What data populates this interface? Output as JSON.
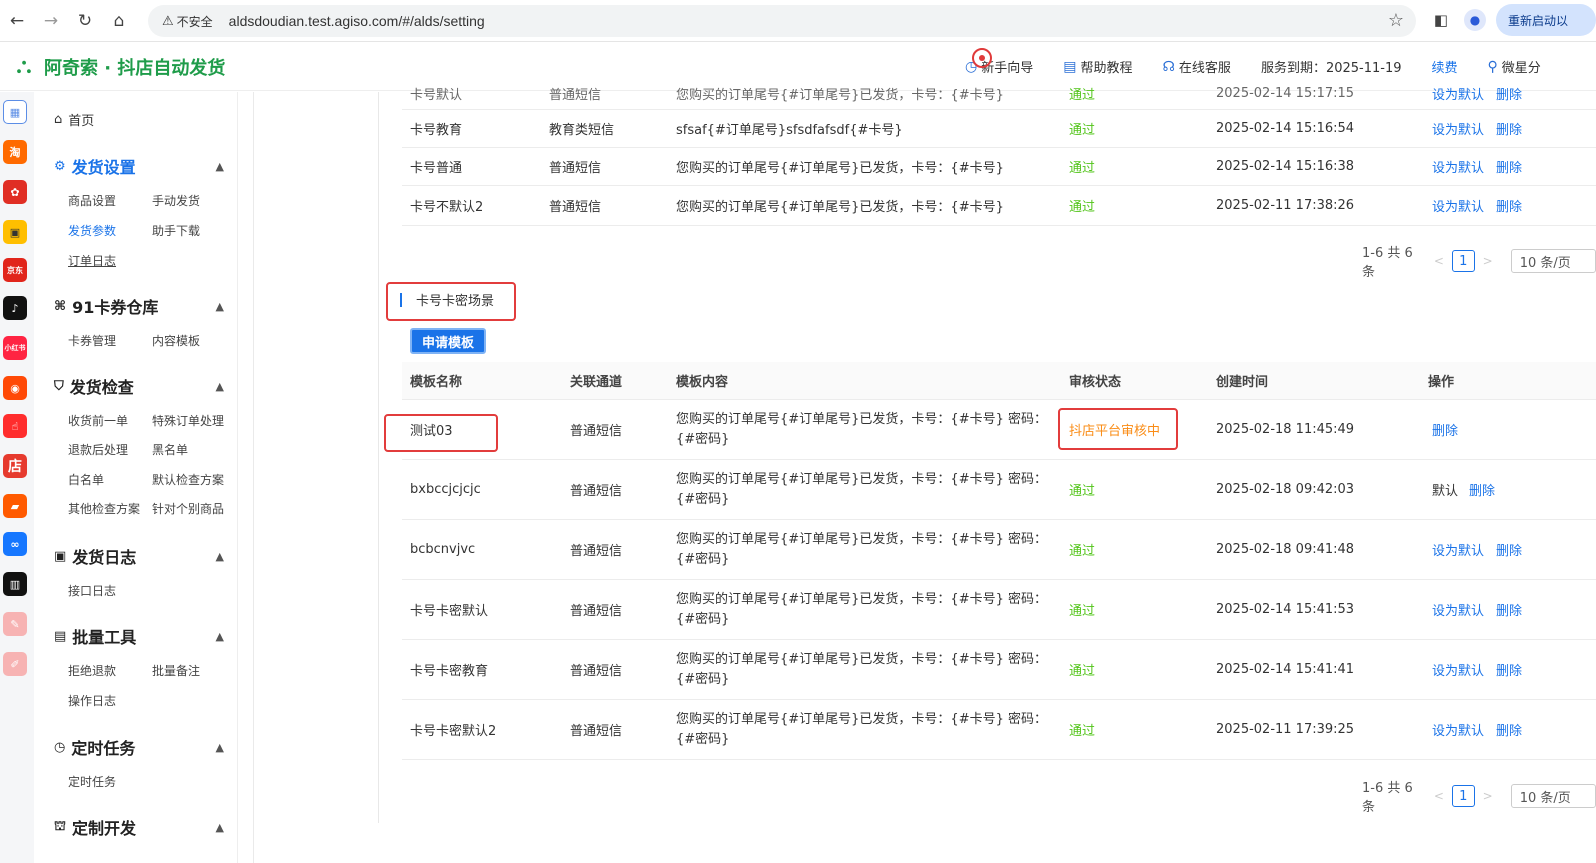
{
  "browser": {
    "insecure_label": "不安全",
    "url": "aldsdoudian.test.agiso.com/#/alds/setting",
    "relaunch_label": "重新启动以"
  },
  "header": {
    "logo_text": "阿奇索 · 抖店自动发货",
    "links": {
      "guide": "新手向导",
      "help": "帮助教程",
      "support": "在线客服",
      "service_expiry": "服务到期：2025-11-19",
      "renew": "续费",
      "user": "微星分"
    }
  },
  "sidebar": {
    "home": "首页",
    "groups": [
      {
        "title": "发货设置",
        "items": [
          "商品设置",
          "手动发货",
          "发货参数",
          "助手下载",
          "订单日志"
        ]
      },
      {
        "title": "91卡券仓库",
        "items": [
          "卡券管理",
          "内容模板"
        ]
      },
      {
        "title": "发货检查",
        "items": [
          "收货前一单",
          "特殊订单处理",
          "退款后处理",
          "黑名单",
          "白名单",
          "默认检查方案",
          "其他检查方案",
          "针对个别商品"
        ]
      },
      {
        "title": "发货日志",
        "items": [
          "接口日志"
        ]
      },
      {
        "title": "批量工具",
        "items": [
          "拒绝退款",
          "批量备注",
          "操作日志"
        ]
      },
      {
        "title": "定时任务",
        "items": [
          "定时任务"
        ]
      },
      {
        "title": "定制开发",
        "items": []
      }
    ]
  },
  "top_table": {
    "rows": [
      {
        "name": "卡号默认",
        "channel": "普通短信",
        "content": "您购买的订单尾号{#订单尾号}已发货，卡号：{#卡号}",
        "status": "通过",
        "time": "2025-02-14 15:17:15",
        "default": "设为默认",
        "delete": "删除"
      },
      {
        "name": "卡号教育",
        "channel": "教育类短信",
        "content": "sfsaf{#订单尾号}sfsdfafsdf{#卡号}",
        "status": "通过",
        "time": "2025-02-14 15:16:54",
        "default": "设为默认",
        "delete": "删除"
      },
      {
        "name": "卡号普通",
        "channel": "普通短信",
        "content": "您购买的订单尾号{#订单尾号}已发货，卡号：{#卡号}",
        "status": "通过",
        "time": "2025-02-14 15:16:38",
        "default": "设为默认",
        "delete": "删除"
      },
      {
        "name": "卡号不默认2",
        "channel": "普通短信",
        "content": "您购买的订单尾号{#订单尾号}已发货，卡号：{#卡号}",
        "status": "通过",
        "time": "2025-02-11 17:38:26",
        "default": "设为默认",
        "delete": "删除"
      }
    ],
    "pager": {
      "summary": "1-6 共 6 条",
      "page": "1",
      "size": "10 条/页"
    }
  },
  "card_section": {
    "title": "卡号卡密场景",
    "apply_button": "申请模板",
    "columns": [
      "模板名称",
      "关联通道",
      "模板内容",
      "审核状态",
      "创建时间",
      "操作"
    ],
    "rows": [
      {
        "name": "测试03",
        "channel": "普通短信",
        "content1": "您购买的订单尾号{#订单尾号}已发货，卡号：{#卡号} 密码：",
        "content2": "{#密码}",
        "status": "抖店平台审核中",
        "time": "2025-02-18 11:45:49",
        "default": "",
        "delete": "删除"
      },
      {
        "name": "bxbccjcjcjc",
        "channel": "普通短信",
        "content1": "您购买的订单尾号{#订单尾号}已发货，卡号：{#卡号} 密码：",
        "content2": "{#密码}",
        "status": "通过",
        "time": "2025-02-18 09:42:03",
        "default": "默认",
        "delete": "删除"
      },
      {
        "name": "bcbcnvjvc",
        "channel": "普通短信",
        "content1": "您购买的订单尾号{#订单尾号}已发货，卡号：{#卡号} 密码：",
        "content2": "{#密码}",
        "status": "通过",
        "time": "2025-02-18 09:41:48",
        "default": "设为默认",
        "delete": "删除"
      },
      {
        "name": "卡号卡密默认",
        "channel": "普通短信",
        "content1": "您购买的订单尾号{#订单尾号}已发货，卡号：{#卡号} 密码：",
        "content2": "{#密码}",
        "status": "通过",
        "time": "2025-02-14 15:41:53",
        "default": "设为默认",
        "delete": "删除"
      },
      {
        "name": "卡号卡密教育",
        "channel": "普通短信",
        "content1": "您购买的订单尾号{#订单尾号}已发货，卡号：{#卡号} 密码：",
        "content2": "{#密码}",
        "status": "通过",
        "time": "2025-02-14 15:41:41",
        "default": "设为默认",
        "delete": "删除"
      },
      {
        "name": "卡号卡密默认2",
        "channel": "普通短信",
        "content1": "您购买的订单尾号{#订单尾号}已发货，卡号：{#卡号} 密码：",
        "content2": "{#密码}",
        "status": "通过",
        "time": "2025-02-11 17:39:25",
        "default": "设为默认",
        "delete": "删除"
      }
    ],
    "pager": {
      "summary": "1-6 共 6 条",
      "page": "1",
      "size": "10 条/页"
    }
  },
  "colors": {
    "accent": "#1a73e8",
    "brand": "#1f9c4a",
    "pass": "#52c41a",
    "pending": "#fa8c16",
    "highlight": "#e23c3c"
  },
  "rail_icons": [
    "grid-icon",
    "taobao-icon",
    "pinduoduo-icon",
    "alibaba-icon",
    "jd-icon",
    "douyin-icon",
    "xiaohongshu-icon",
    "kuaishou-icon",
    "thumb-icon",
    "shop-icon",
    "bag-icon",
    "link-icon",
    "weidian-icon",
    "pink-a-icon",
    "pink-b-icon"
  ],
  "rail_labels": [
    "淘",
    "京东",
    "小红书",
    "店"
  ]
}
